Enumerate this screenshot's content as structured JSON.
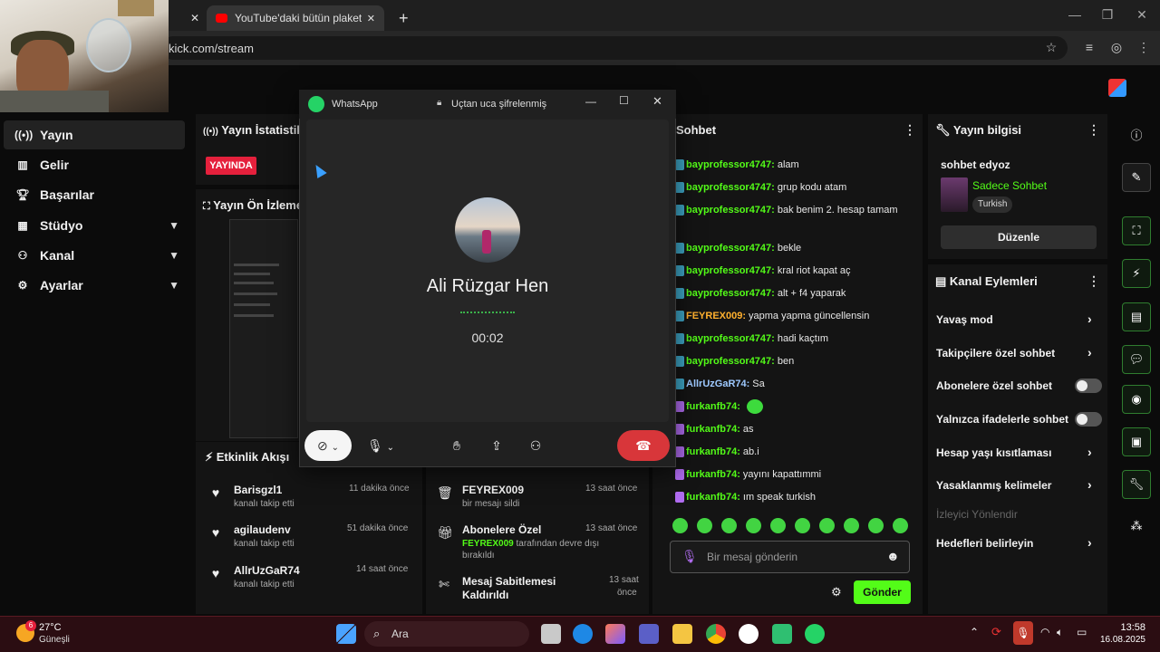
{
  "browser": {
    "tab_title": "YouTube'daki bütün plaketler n",
    "url": "kick.com/stream"
  },
  "nav": {
    "items": [
      {
        "label": "Yayın",
        "icon": "broadcast-icon"
      },
      {
        "label": "Gelir",
        "icon": "chart-icon"
      },
      {
        "label": "Başarılar",
        "icon": "trophy-icon"
      },
      {
        "label": "Stüdyo",
        "icon": "grid-icon"
      },
      {
        "label": "Kanal",
        "icon": "users-icon"
      },
      {
        "label": "Ayarlar",
        "icon": "gear-icon"
      }
    ]
  },
  "stats": {
    "title": "Yayın İstatistikl",
    "live": "YAYINDA"
  },
  "preview": {
    "title": "Yayın Ön İzleme"
  },
  "activity": {
    "title": "Etkinlik Akışı",
    "left": [
      {
        "name": "Barisgzl1",
        "sub": "kanalı takip etti",
        "time": "11 dakika önce"
      },
      {
        "name": "agilaudenv",
        "sub": "kanalı takip etti",
        "time": "51 dakika önce"
      },
      {
        "name": "AllrUzGaR74",
        "sub": "kanalı takip etti",
        "time": "14 saat önce"
      }
    ],
    "right": [
      {
        "name": "FEYREX009",
        "sub": "bir mesajı sildi",
        "time": "13 saat önce"
      },
      {
        "name": "Abonelere Özel",
        "sub_user": "FEYREX009",
        "sub": "tarafından devre dışı",
        "sub2": "bırakıldı",
        "time": "13 saat önce"
      },
      {
        "name": "Mesaj Sabitlemesi",
        "name2": "Kaldırıldı",
        "time": "13 saat",
        "time2": "önce"
      }
    ]
  },
  "chat": {
    "title": "Sohbet",
    "messages": [
      {
        "user": "bayprofessor4747",
        "text": "alam",
        "color": "#53fc18"
      },
      {
        "user": "bayprofessor4747",
        "text": "grup kodu atam",
        "color": "#53fc18"
      },
      {
        "user": "bayprofessor4747",
        "text": "bak benim 2. hesap tamam",
        "color": "#53fc18"
      },
      {
        "user": "bayprofessor4747",
        "text": "bekle",
        "color": "#53fc18"
      },
      {
        "user": "bayprofessor4747",
        "text": "kral riot kapat aç",
        "color": "#53fc18"
      },
      {
        "user": "bayprofessor4747",
        "text": "alt + f4 yaparak",
        "color": "#53fc18"
      },
      {
        "user": "FEYREX009",
        "text": "yapma yapma güncellensin",
        "color": "#ffb02e"
      },
      {
        "user": "bayprofessor4747",
        "text": "hadi kaçtım",
        "color": "#53fc18"
      },
      {
        "user": "bayprofessor4747",
        "text": "ben",
        "color": "#53fc18"
      },
      {
        "user": "AllrUzGaR74",
        "text": "Sa",
        "color": "#9ec9ff"
      },
      {
        "user": "furkanfb74",
        "text": "",
        "color": "#53fc18"
      },
      {
        "user": "furkanfb74",
        "text": "as",
        "color": "#53fc18"
      },
      {
        "user": "furkanfb74",
        "text": "ab.i",
        "color": "#53fc18"
      },
      {
        "user": "furkanfb74",
        "text": "yayını kapattımmi",
        "color": "#53fc18"
      },
      {
        "user": "furkanfb74",
        "text": "ım speak turkish",
        "color": "#53fc18"
      }
    ],
    "input_placeholder": "Bir mesaj gönderin",
    "send_label": "Gönder"
  },
  "stream_info": {
    "title": "Yayın bilgisi",
    "stream_title": "sohbet edyoz",
    "category": "Sadece Sohbet",
    "language": "Turkish",
    "edit_label": "Düzenle"
  },
  "channel_actions": {
    "title": "Kanal Eylemleri",
    "items": [
      {
        "label": "Yavaş mod",
        "type": "chevron"
      },
      {
        "label": "Takipçilere özel sohbet",
        "type": "chevron"
      },
      {
        "label": "Abonelere özel sohbet",
        "type": "toggle"
      },
      {
        "label": "Yalnızca ifadelerle sohbet",
        "type": "toggle"
      },
      {
        "label": "Hesap yaşı kısıtlaması",
        "type": "chevron"
      },
      {
        "label": "Yasaklanmış kelimeler",
        "type": "chevron"
      }
    ],
    "redirect_label": "İzleyici Yönlendir",
    "goals_label": "Hedefleri belirleyin"
  },
  "whatsapp": {
    "app_name": "WhatsApp",
    "encryption": "Uçtan uca şifrelenmiş",
    "caller": "Ali Rüzgar Hen",
    "timer": "00:02"
  },
  "taskbar": {
    "temp": "27°C",
    "weather": "Güneşli",
    "badge": "6",
    "search": "Ara",
    "time": "13:58",
    "date": "16.08.2025"
  },
  "colors": {
    "kick_green": "#53fc18",
    "live_red": "#e5203c",
    "end_call_red": "#d8363a",
    "taskbar": "#2b0d12"
  }
}
